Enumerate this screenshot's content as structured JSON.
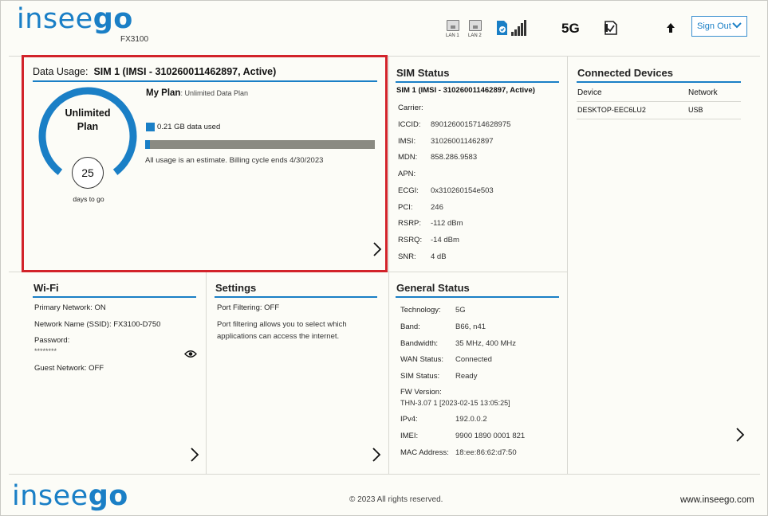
{
  "header": {
    "logo_light": "insee",
    "logo_bold": "go",
    "model": "FX3100",
    "lan1": "LAN 1",
    "lan2": "LAN 2",
    "network_type": "5G",
    "sign_out": "Sign Out"
  },
  "data_usage": {
    "title_prefix": "Data Usage:",
    "title_sim": "SIM 1 (IMSI - 310260011462897, Active)",
    "gauge_label_1": "Unlimited",
    "gauge_label_2": "Plan",
    "days": "25",
    "days_label": "days to go",
    "my_plan_label": "My Plan",
    "my_plan_value": ": Unlimited Data Plan",
    "used_text": "0.21 GB data used",
    "used_fraction": 0.02,
    "estimate_text": "All usage is an estimate. Billing cycle ends 4/30/2023"
  },
  "sim_status": {
    "title": "SIM Status",
    "subtitle": "SIM 1 (IMSI - 310260011462897, Active)",
    "rows": [
      {
        "k": "Carrier:",
        "v": ""
      },
      {
        "k": "ICCID:",
        "v": "8901260015714628975"
      },
      {
        "k": "IMSI:",
        "v": "310260011462897"
      },
      {
        "k": "MDN:",
        "v": "858.286.9583"
      },
      {
        "k": "APN:",
        "v": ""
      },
      {
        "k": "ECGI:",
        "v": "0x310260154e503"
      },
      {
        "k": "PCI:",
        "v": "246"
      },
      {
        "k": "RSRP:",
        "v": "-112 dBm"
      },
      {
        "k": "RSRQ:",
        "v": "-14 dBm"
      },
      {
        "k": "SNR:",
        "v": "4 dB"
      }
    ]
  },
  "connected_devices": {
    "title": "Connected Devices",
    "col_device": "Device",
    "col_network": "Network",
    "rows": [
      {
        "device": "DESKTOP-EEC6LU2",
        "network": "USB"
      }
    ]
  },
  "wifi": {
    "title": "Wi-Fi",
    "primary_label": "Primary Network:",
    "primary_value": " ON",
    "ssid_label": "Network Name (SSID):",
    "ssid_value": " FX3100-D750",
    "password_label": "Password:",
    "password_value": "********",
    "guest_label": "Guest Network:",
    "guest_value": " OFF"
  },
  "settings": {
    "title": "Settings",
    "port_label": "Port Filtering:",
    "port_value": " OFF",
    "desc": "Port filtering allows you to select which applications can access the internet."
  },
  "general_status": {
    "title": "General Status",
    "rows": [
      {
        "k": "Technology:",
        "v": "5G"
      },
      {
        "k": "Band:",
        "v": "B66, n41"
      },
      {
        "k": "Bandwidth:",
        "v": "35 MHz, 400 MHz"
      },
      {
        "k": "WAN Status:",
        "v": "Connected"
      },
      {
        "k": "SIM Status:",
        "v": "Ready"
      }
    ],
    "fw_label": "FW Version:",
    "fw_value": "THN-3.07 1 [2023-02-15 13:05:25]",
    "rows2": [
      {
        "k": "IPv4:",
        "v": "192.0.0.2"
      },
      {
        "k": "IMEI:",
        "v": "9900 1890 0001 821"
      },
      {
        "k": "MAC Address:",
        "v": "18:ee:86:62:d7:50"
      }
    ]
  },
  "footer": {
    "copyright": "© 2023 All rights reserved.",
    "website": "www.inseego.com"
  },
  "colors": {
    "brand": "#1a7fc6",
    "highlight": "#d2232a",
    "bar_gray": "#8a8a82"
  }
}
